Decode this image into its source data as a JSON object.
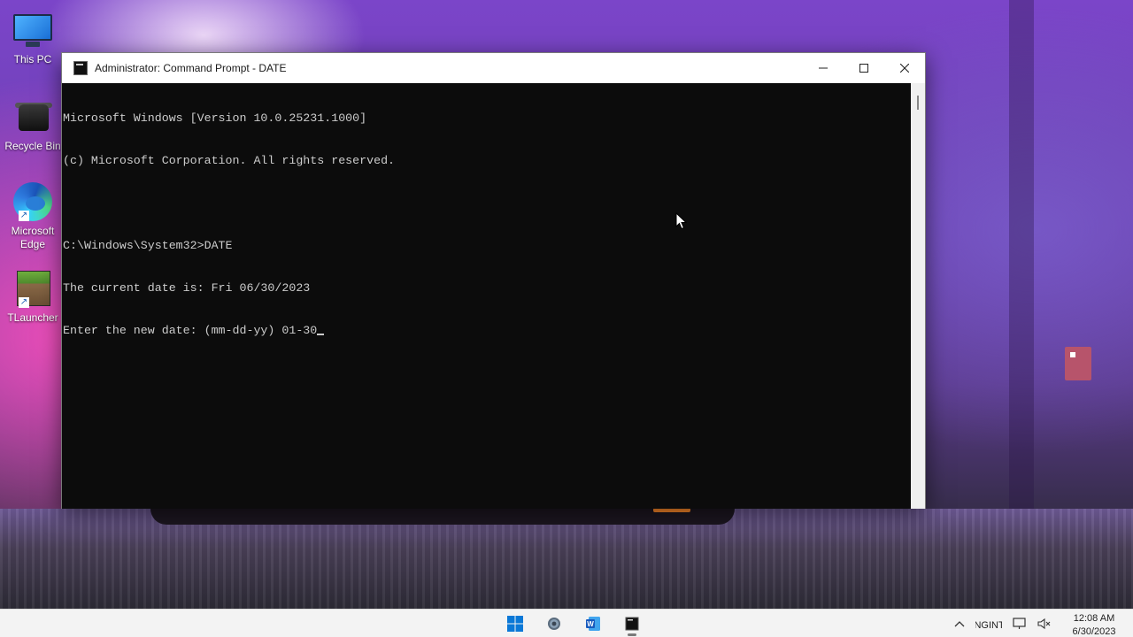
{
  "desktop": {
    "icons": [
      {
        "label": "This PC",
        "icon": "this-pc-icon"
      },
      {
        "label": "Recycle Bin",
        "icon": "recycle-bin-icon"
      },
      {
        "label": "Microsoft Edge",
        "icon": "edge-icon"
      },
      {
        "label": "TLauncher",
        "icon": "tlauncher-icon"
      }
    ]
  },
  "window": {
    "title": "Administrator: Command Prompt - DATE",
    "controls": {
      "minimize": "minimize-icon",
      "maximize": "maximize-icon",
      "close": "close-icon"
    },
    "console": {
      "lines": [
        "Microsoft Windows [Version 10.0.25231.1000]",
        "(c) Microsoft Corporation. All rights reserved.",
        "",
        "C:\\Windows\\System32>DATE",
        "The current date is: Fri 06/30/2023",
        "Enter the new date: (mm-dd-yy) 01-30"
      ]
    }
  },
  "taskbar": {
    "apps": [
      {
        "name": "start",
        "icon": "windows-start-icon"
      },
      {
        "name": "settings",
        "icon": "settings-gear-icon"
      },
      {
        "name": "word",
        "icon": "word-icon"
      },
      {
        "name": "command-prompt",
        "icon": "command-prompt-icon"
      }
    ],
    "tray": {
      "language_line1": "ENG",
      "language_line2": "INTL",
      "time": "12:08 AM",
      "date": "6/30/2023"
    }
  },
  "colors": {
    "console_bg": "#0c0c0c",
    "console_text": "#cccccc",
    "taskbar_bg": "#f3f3f3",
    "windows_blue": "#0078d4"
  }
}
